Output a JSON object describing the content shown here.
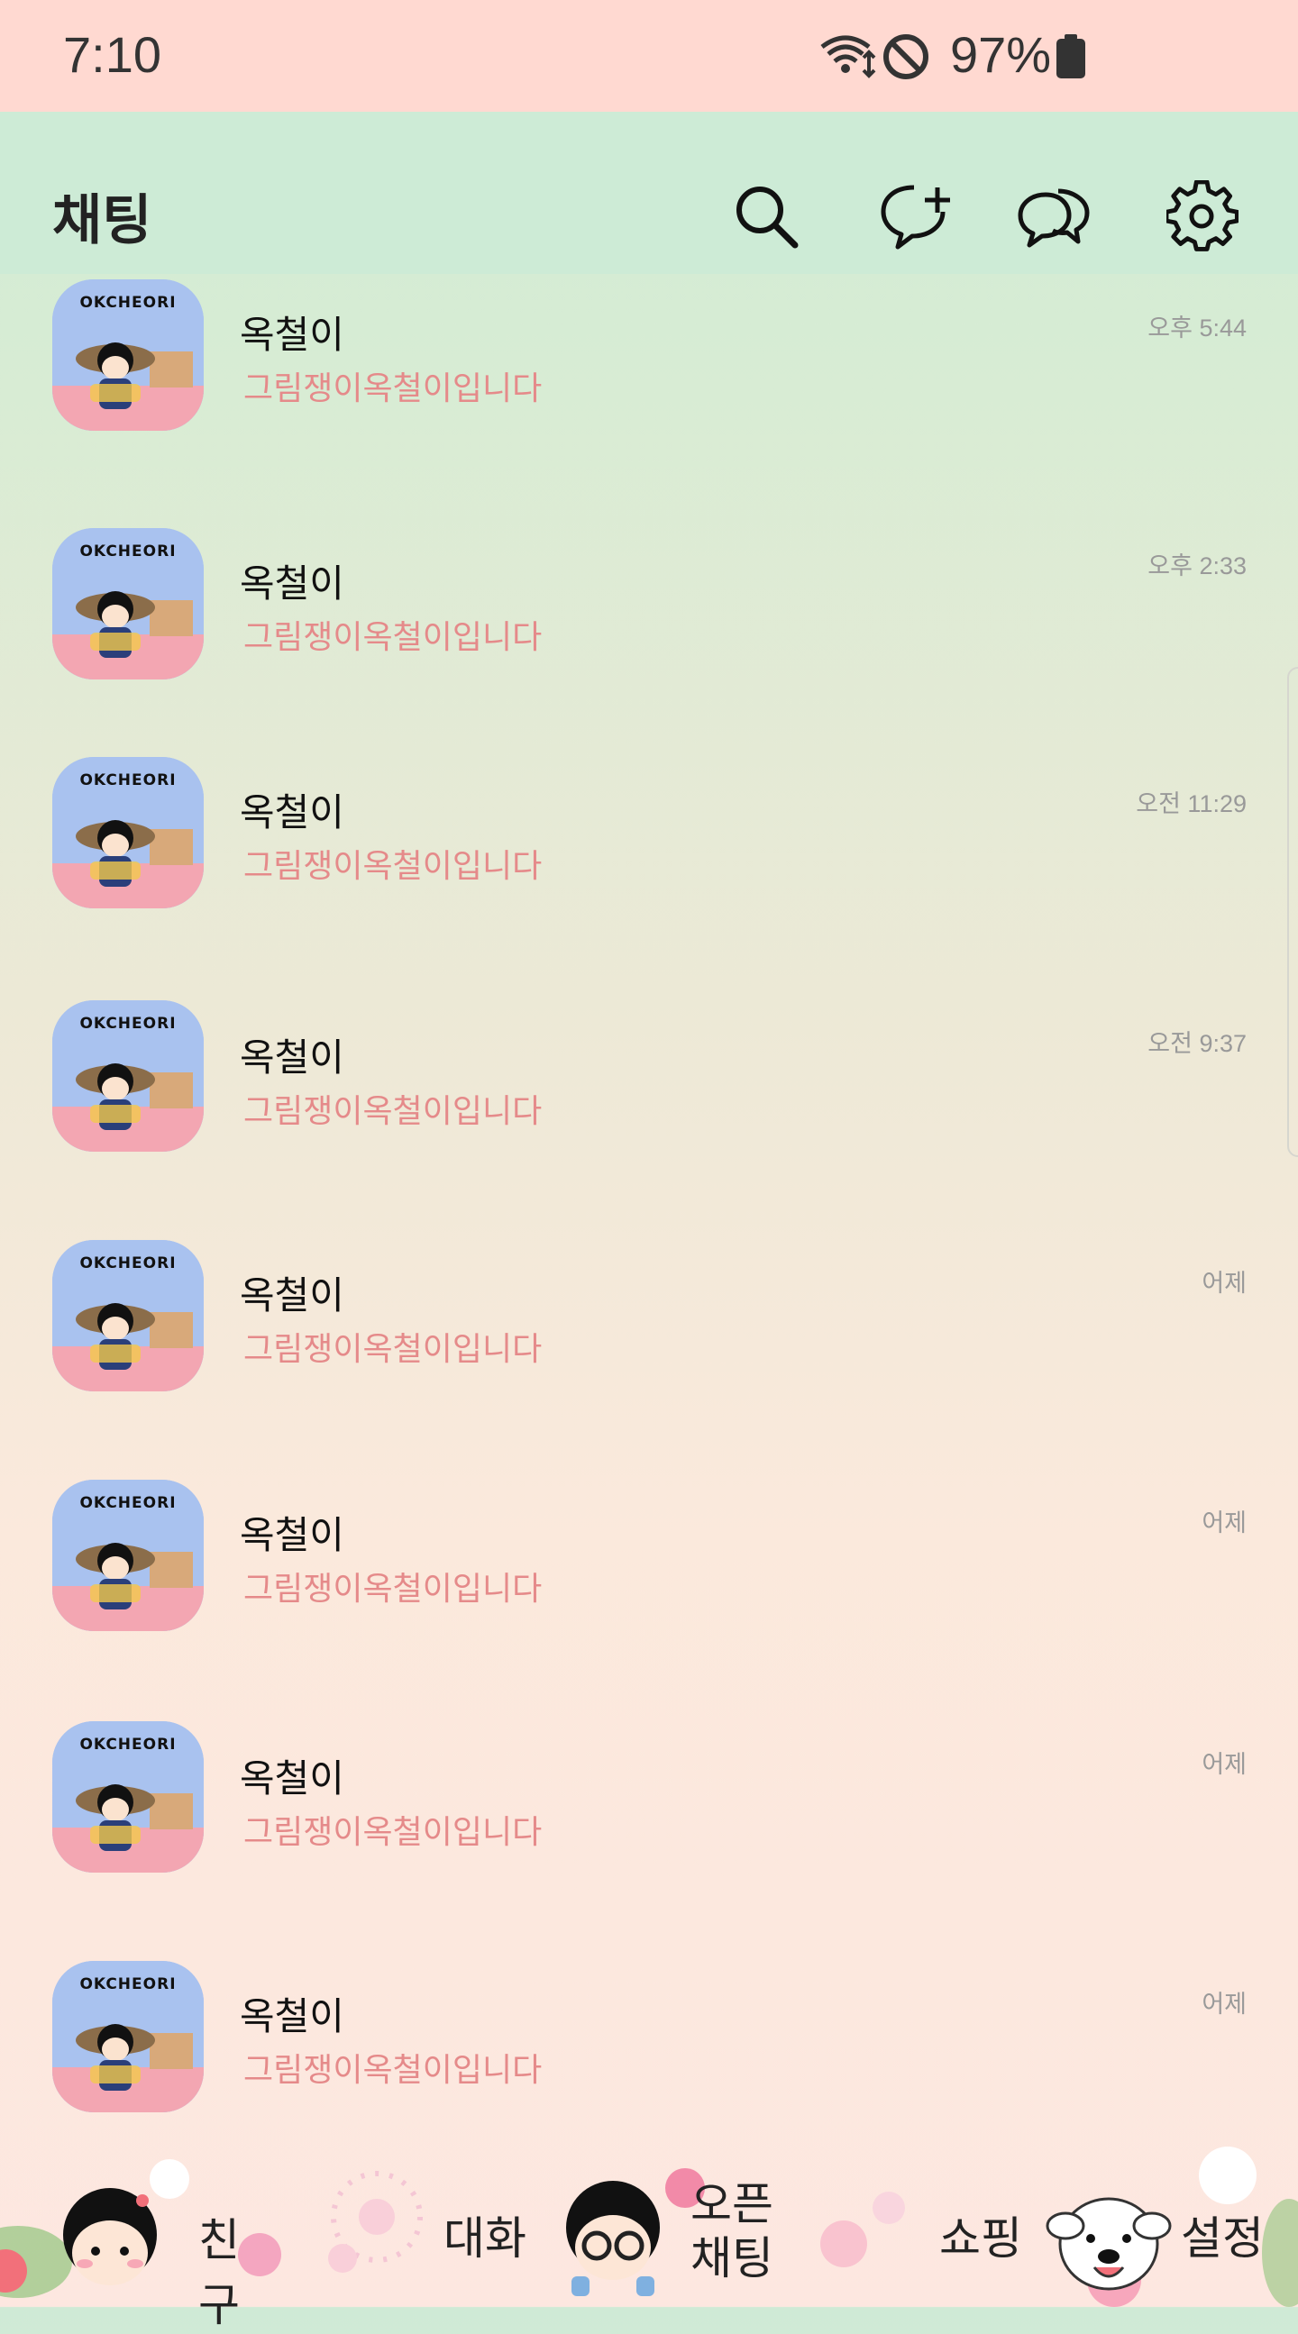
{
  "status_bar": {
    "time": "7:10",
    "battery": "97%",
    "icons": [
      "wifi-icon",
      "do-not-disturb-icon",
      "battery-icon"
    ]
  },
  "header": {
    "title": "채팅",
    "buttons": [
      "search-icon",
      "new-chat-icon",
      "open-chat-icon",
      "settings-icon"
    ]
  },
  "chats": [
    {
      "name": "옥철이",
      "message": "그림쟁이옥철이입니다",
      "time": "오후 5:44",
      "avatar_label": "OKCHEORI"
    },
    {
      "name": "옥철이",
      "message": "그림쟁이옥철이입니다",
      "time": "오후 2:33",
      "avatar_label": "OKCHEORI"
    },
    {
      "name": "옥철이",
      "message": "그림쟁이옥철이입니다",
      "time": "오전 11:29",
      "avatar_label": "OKCHEORI"
    },
    {
      "name": "옥철이",
      "message": "그림쟁이옥철이입니다",
      "time": "오전 9:37",
      "avatar_label": "OKCHEORI"
    },
    {
      "name": "옥철이",
      "message": "그림쟁이옥철이입니다",
      "time": "어제",
      "avatar_label": "OKCHEORI"
    },
    {
      "name": "옥철이",
      "message": "그림쟁이옥철이입니다",
      "time": "어제",
      "avatar_label": "OKCHEORI"
    },
    {
      "name": "옥철이",
      "message": "그림쟁이옥철이입니다",
      "time": "어제",
      "avatar_label": "OKCHEORI"
    },
    {
      "name": "옥철이",
      "message": "그림쟁이옥철이입니다",
      "time": "어제",
      "avatar_label": "OKCHEORI"
    }
  ],
  "bottom_nav": {
    "friends": "친구",
    "chats": "대화",
    "open_chat_1": "오픈",
    "open_chat_2": "채팅",
    "shopping": "쇼핑",
    "settings": "설정"
  },
  "colors": {
    "status_bar_bg": "#ffd9d1",
    "header_bg": "#cdebd6",
    "message_text": "#e58a8a",
    "time_text": "#999999"
  }
}
